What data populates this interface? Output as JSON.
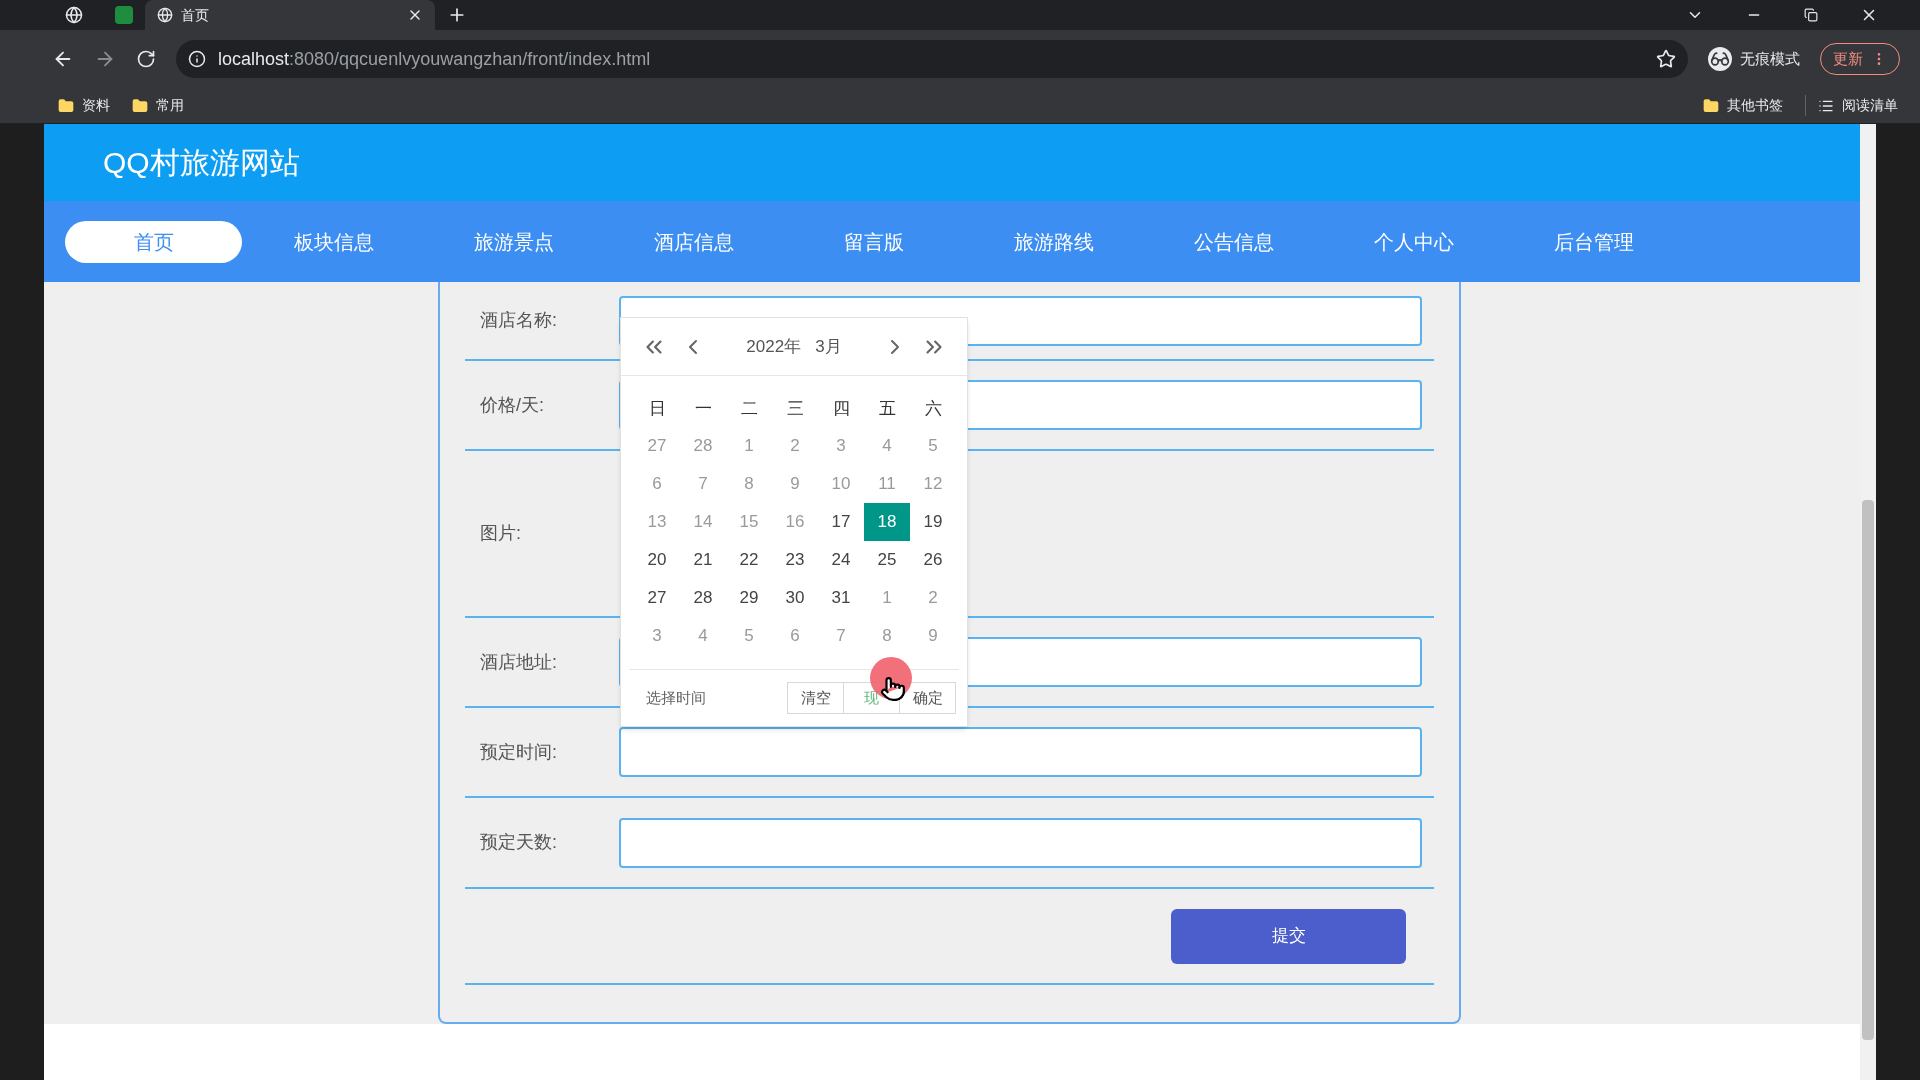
{
  "browser": {
    "tabs": [
      {
        "title": "首页",
        "selected": true
      }
    ],
    "url_host": "localhost",
    "url_path": ":8080/qqcuenlvyouwangzhan/front/index.html",
    "profile": "无痕模式",
    "update": "更新",
    "bookmarks_left": [
      "资料",
      "常用"
    ],
    "bookmarks_right": [
      "其他书签"
    ],
    "reading_list": "阅读清单"
  },
  "site_title": "QQ村旅游网站",
  "nav": [
    {
      "label": "首页",
      "selected": true
    },
    {
      "label": "板块信息",
      "selected": false
    },
    {
      "label": "旅游景点",
      "selected": false
    },
    {
      "label": "酒店信息",
      "selected": false
    },
    {
      "label": "留言版",
      "selected": false
    },
    {
      "label": "旅游路线",
      "selected": false
    },
    {
      "label": "公告信息",
      "selected": false
    },
    {
      "label": "个人中心",
      "selected": false
    },
    {
      "label": "后台管理",
      "selected": false
    }
  ],
  "form": {
    "fields": [
      {
        "label": "酒店名称:",
        "kind": "input"
      },
      {
        "label": "价格/天:",
        "kind": "input"
      },
      {
        "label": "图片:",
        "kind": "image"
      },
      {
        "label": "酒店地址:",
        "kind": "input"
      },
      {
        "label": "预定时间:",
        "kind": "input"
      },
      {
        "label": "预定天数:",
        "kind": "input"
      }
    ],
    "submit": "提交"
  },
  "datepicker": {
    "year": "2022年",
    "month": "3月",
    "weekdays": [
      "日",
      "一",
      "二",
      "三",
      "四",
      "五",
      "六"
    ],
    "days": [
      {
        "day": "27",
        "muted": true,
        "selected": false
      },
      {
        "day": "28",
        "muted": true,
        "selected": false
      },
      {
        "day": "1",
        "muted": true,
        "selected": false
      },
      {
        "day": "2",
        "muted": true,
        "selected": false
      },
      {
        "day": "3",
        "muted": true,
        "selected": false
      },
      {
        "day": "4",
        "muted": true,
        "selected": false
      },
      {
        "day": "5",
        "muted": true,
        "selected": false
      },
      {
        "day": "6",
        "muted": true,
        "selected": false
      },
      {
        "day": "7",
        "muted": true,
        "selected": false
      },
      {
        "day": "8",
        "muted": true,
        "selected": false
      },
      {
        "day": "9",
        "muted": true,
        "selected": false
      },
      {
        "day": "10",
        "muted": true,
        "selected": false
      },
      {
        "day": "11",
        "muted": true,
        "selected": false
      },
      {
        "day": "12",
        "muted": true,
        "selected": false
      },
      {
        "day": "13",
        "muted": true,
        "selected": false
      },
      {
        "day": "14",
        "muted": true,
        "selected": false
      },
      {
        "day": "15",
        "muted": true,
        "selected": false
      },
      {
        "day": "16",
        "muted": true,
        "selected": false
      },
      {
        "day": "17",
        "muted": false,
        "selected": false
      },
      {
        "day": "18",
        "muted": false,
        "selected": true
      },
      {
        "day": "19",
        "muted": false,
        "selected": false
      },
      {
        "day": "20",
        "muted": false,
        "selected": false
      },
      {
        "day": "21",
        "muted": false,
        "selected": false
      },
      {
        "day": "22",
        "muted": false,
        "selected": false
      },
      {
        "day": "23",
        "muted": false,
        "selected": false
      },
      {
        "day": "24",
        "muted": false,
        "selected": false
      },
      {
        "day": "25",
        "muted": false,
        "selected": false
      },
      {
        "day": "26",
        "muted": false,
        "selected": false
      },
      {
        "day": "27",
        "muted": false,
        "selected": false
      },
      {
        "day": "28",
        "muted": false,
        "selected": false
      },
      {
        "day": "29",
        "muted": false,
        "selected": false
      },
      {
        "day": "30",
        "muted": false,
        "selected": false
      },
      {
        "day": "31",
        "muted": false,
        "selected": false
      },
      {
        "day": "1",
        "muted": true,
        "selected": false
      },
      {
        "day": "2",
        "muted": true,
        "selected": false
      },
      {
        "day": "3",
        "muted": true,
        "selected": false
      },
      {
        "day": "4",
        "muted": true,
        "selected": false
      },
      {
        "day": "5",
        "muted": true,
        "selected": false
      },
      {
        "day": "6",
        "muted": true,
        "selected": false
      },
      {
        "day": "7",
        "muted": true,
        "selected": false
      },
      {
        "day": "8",
        "muted": true,
        "selected": false
      },
      {
        "day": "9",
        "muted": true,
        "selected": false
      }
    ],
    "footer_label": "选择时间",
    "buttons": [
      {
        "label": "清空",
        "kind": "plain"
      },
      {
        "label": "现",
        "kind": "accent"
      },
      {
        "label": "确定",
        "kind": "plain"
      }
    ]
  }
}
